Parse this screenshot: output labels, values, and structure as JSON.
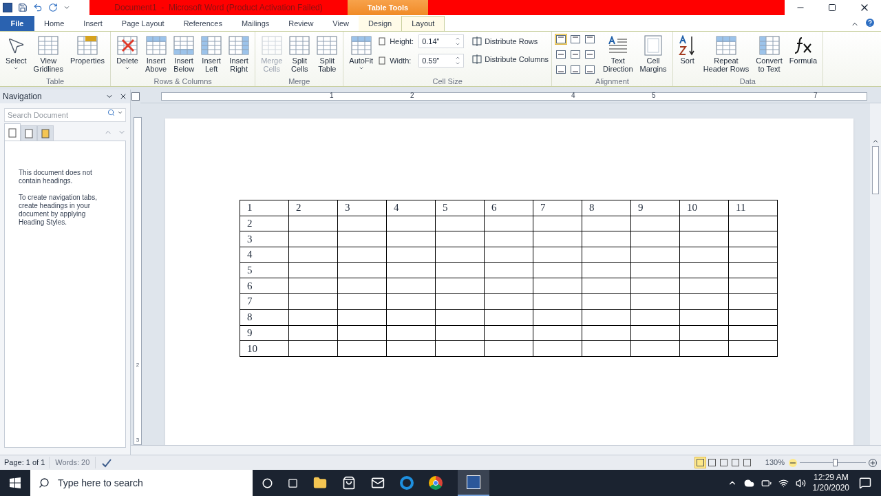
{
  "title_bar": {
    "title": "Document1  -  Microsoft Word (Product Activation Failed)",
    "context_tab": "Table Tools"
  },
  "tabs": [
    {
      "label": "File",
      "kind": "file",
      "selected": false
    },
    {
      "label": "Home",
      "kind": "tab",
      "selected": false
    },
    {
      "label": "Insert",
      "kind": "tab",
      "selected": false
    },
    {
      "label": "Page Layout",
      "kind": "tab",
      "selected": false
    },
    {
      "label": "References",
      "kind": "tab",
      "selected": false
    },
    {
      "label": "Mailings",
      "kind": "tab",
      "selected": false
    },
    {
      "label": "Review",
      "kind": "tab",
      "selected": false
    },
    {
      "label": "View",
      "kind": "tab",
      "selected": false
    },
    {
      "label": "Design",
      "kind": "context",
      "selected": false
    },
    {
      "label": "Layout",
      "kind": "context",
      "selected": true
    }
  ],
  "ribbon": [
    {
      "label": "Table",
      "items": [
        {
          "kind": "big",
          "lines": [
            "Select"
          ],
          "dropdown": true,
          "disabled": false
        },
        {
          "kind": "big",
          "lines": [
            "View",
            "Gridlines"
          ],
          "dropdown": false,
          "disabled": false
        },
        {
          "kind": "big",
          "lines": [
            "Properties"
          ],
          "dropdown": false,
          "disabled": false
        }
      ]
    },
    {
      "label": "Rows & Columns",
      "items": [
        {
          "kind": "big",
          "lines": [
            "Delete"
          ],
          "dropdown": true,
          "disabled": false
        },
        {
          "kind": "big",
          "lines": [
            "Insert",
            "Above"
          ],
          "dropdown": false,
          "disabled": false
        },
        {
          "kind": "big",
          "lines": [
            "Insert",
            "Below"
          ],
          "dropdown": false,
          "disabled": false
        },
        {
          "kind": "big",
          "lines": [
            "Insert",
            "Left"
          ],
          "dropdown": false,
          "disabled": false
        },
        {
          "kind": "big",
          "lines": [
            "Insert",
            "Right"
          ],
          "dropdown": false,
          "disabled": false
        }
      ]
    },
    {
      "label": "Merge",
      "items": [
        {
          "kind": "big",
          "lines": [
            "Merge",
            "Cells"
          ],
          "dropdown": false,
          "disabled": true
        },
        {
          "kind": "big",
          "lines": [
            "Split",
            "Cells"
          ],
          "dropdown": false,
          "disabled": false
        },
        {
          "kind": "big",
          "lines": [
            "Split",
            "Table"
          ],
          "dropdown": false,
          "disabled": false
        }
      ]
    },
    {
      "label": "Cell Size",
      "items": [
        {
          "kind": "big",
          "lines": [
            "AutoFit"
          ],
          "dropdown": true,
          "disabled": false
        },
        {
          "kind": "sizes",
          "fields": [
            {
              "label": "Height:",
              "value": "0.14\""
            },
            {
              "label": "Width:",
              "value": "0.59\""
            }
          ],
          "actions": [
            "Distribute Rows",
            "Distribute Columns"
          ]
        }
      ]
    },
    {
      "label": "Alignment",
      "items": [
        {
          "kind": "align",
          "cells": [
            {
              "selected": true
            },
            {
              "selected": false
            },
            {
              "selected": false
            },
            {
              "selected": false
            },
            {
              "selected": false
            },
            {
              "selected": false
            },
            {
              "selected": false
            },
            {
              "selected": false
            },
            {
              "selected": false
            }
          ]
        },
        {
          "kind": "big",
          "lines": [
            "Text",
            "Direction"
          ],
          "dropdown": false,
          "disabled": false
        },
        {
          "kind": "big",
          "lines": [
            "Cell",
            "Margins"
          ],
          "dropdown": false,
          "disabled": false
        }
      ]
    },
    {
      "label": "Data",
      "items": [
        {
          "kind": "big",
          "lines": [
            "Sort"
          ],
          "dropdown": false,
          "disabled": false
        },
        {
          "kind": "big",
          "lines": [
            "Repeat",
            "Header Rows"
          ],
          "dropdown": false,
          "disabled": false
        },
        {
          "kind": "big",
          "lines": [
            "Convert",
            "to Text"
          ],
          "dropdown": false,
          "disabled": false
        },
        {
          "kind": "big",
          "lines": [
            "Formula"
          ],
          "dropdown": false,
          "disabled": false
        }
      ]
    }
  ],
  "navigation": {
    "title": "Navigation",
    "search": {
      "placeholder": "Search Document"
    },
    "views": [
      {
        "selected": true
      },
      {
        "selected": false
      },
      {
        "selected": false
      }
    ],
    "messages": [
      "This document does not contain headings.",
      "To create navigation tabs, create headings in your document by applying Heading Styles."
    ]
  },
  "ruler": {
    "labels": [
      "1",
      "2",
      "4",
      "5",
      "7"
    ],
    "vertical_labels": [
      "2",
      "3"
    ]
  },
  "table": {
    "rows": [
      {
        "cells": [
          "1",
          "2",
          "3",
          "4",
          "5",
          "6",
          "7",
          "8",
          "9",
          "10",
          "11"
        ]
      },
      {
        "cells": [
          "2"
        ]
      },
      {
        "cells": [
          "3"
        ]
      },
      {
        "cells": [
          "4"
        ]
      },
      {
        "cells": [
          "5"
        ]
      },
      {
        "cells": [
          "6"
        ]
      },
      {
        "cells": [
          "7"
        ]
      },
      {
        "cells": [
          "8"
        ]
      },
      {
        "cells": [
          "9"
        ]
      },
      {
        "cells": [
          "10"
        ]
      }
    ]
  },
  "status_bar": {
    "page": "Page: 1 of 1",
    "words": "Words: 20",
    "views": [
      {
        "selected": true
      },
      {
        "selected": false
      },
      {
        "selected": false
      },
      {
        "selected": false
      },
      {
        "selected": false
      }
    ],
    "zoom": "130%",
    "zoom_slider": {
      "level": 0.53
    }
  },
  "taskbar": {
    "search": {
      "placeholder": "Type here to search"
    },
    "time": "12:29 AM",
    "date": "1/20/2020"
  }
}
